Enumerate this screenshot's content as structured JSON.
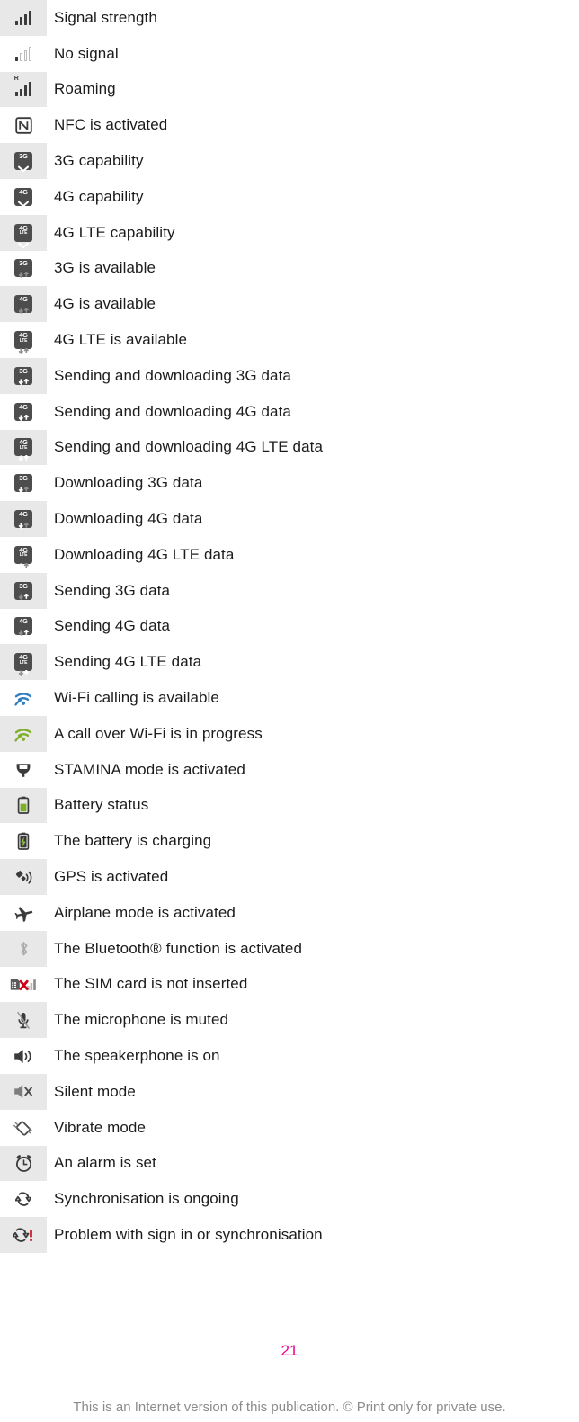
{
  "document": {
    "page_number": "21",
    "footer_note": "This is an Internet version of this publication. © Print only for private use.",
    "page_number_color": "#ec008c",
    "footer_note_color": "#8c8c8c",
    "row_shade_color": "#e8e8e8",
    "badge_color": "#4d4d4d"
  },
  "status_icons": {
    "rows": [
      {
        "icon": "signal-strength-icon",
        "label": "Signal strength",
        "shaded": true
      },
      {
        "icon": "no-signal-icon",
        "label": "No signal",
        "shaded": false
      },
      {
        "icon": "roaming-icon",
        "label": "Roaming",
        "shaded": true
      },
      {
        "icon": "nfc-icon",
        "label": "NFC is activated",
        "shaded": false
      },
      {
        "icon": "3g-capability-icon",
        "label": "3G capability",
        "shaded": true
      },
      {
        "icon": "4g-capability-icon",
        "label": "4G capability",
        "shaded": false
      },
      {
        "icon": "4g-lte-capability-icon",
        "label": "4G LTE capability",
        "shaded": true
      },
      {
        "icon": "3g-available-icon",
        "label": "3G is available",
        "shaded": false
      },
      {
        "icon": "4g-available-icon",
        "label": "4G is available",
        "shaded": true
      },
      {
        "icon": "4g-lte-available-icon",
        "label": "4G LTE is available",
        "shaded": false
      },
      {
        "icon": "3g-send-receive-icon",
        "label": "Sending and downloading 3G data",
        "shaded": true
      },
      {
        "icon": "4g-send-receive-icon",
        "label": "Sending and downloading 4G data",
        "shaded": false
      },
      {
        "icon": "4g-lte-send-receive-icon",
        "label": "Sending and downloading 4G LTE data",
        "shaded": true
      },
      {
        "icon": "3g-download-icon",
        "label": "Downloading 3G data",
        "shaded": false
      },
      {
        "icon": "4g-download-icon",
        "label": "Downloading 4G data",
        "shaded": true
      },
      {
        "icon": "4g-lte-download-icon",
        "label": "Downloading 4G LTE data",
        "shaded": false
      },
      {
        "icon": "3g-upload-icon",
        "label": "Sending 3G data",
        "shaded": true
      },
      {
        "icon": "4g-upload-icon",
        "label": "Sending 4G data",
        "shaded": false
      },
      {
        "icon": "4g-lte-upload-icon",
        "label": "Sending 4G LTE data",
        "shaded": true
      },
      {
        "icon": "wifi-calling-available-icon",
        "label": "Wi-Fi calling is available",
        "shaded": false
      },
      {
        "icon": "wifi-call-in-progress-icon",
        "label": "A call over Wi-Fi is in progress",
        "shaded": true
      },
      {
        "icon": "stamina-mode-icon",
        "label": "STAMINA mode is activated",
        "shaded": false
      },
      {
        "icon": "battery-status-icon",
        "label": "Battery status",
        "shaded": true
      },
      {
        "icon": "battery-charging-icon",
        "label": "The battery is charging",
        "shaded": false
      },
      {
        "icon": "gps-icon",
        "label": "GPS is activated",
        "shaded": true
      },
      {
        "icon": "airplane-mode-icon",
        "label": "Airplane mode is activated",
        "shaded": false
      },
      {
        "icon": "bluetooth-icon",
        "label": "The Bluetooth® function is activated",
        "shaded": true
      },
      {
        "icon": "no-sim-card-icon",
        "label": "The SIM card is not inserted",
        "shaded": false
      },
      {
        "icon": "microphone-muted-icon",
        "label": "The microphone is muted",
        "shaded": true
      },
      {
        "icon": "speakerphone-icon",
        "label": "The speakerphone is on",
        "shaded": false
      },
      {
        "icon": "silent-mode-icon",
        "label": "Silent mode",
        "shaded": true
      },
      {
        "icon": "vibrate-mode-icon",
        "label": "Vibrate mode",
        "shaded": false
      },
      {
        "icon": "alarm-icon",
        "label": "An alarm is set",
        "shaded": true
      },
      {
        "icon": "sync-ongoing-icon",
        "label": "Synchronisation is ongoing",
        "shaded": false
      },
      {
        "icon": "sync-problem-icon",
        "label": "Problem with sign in or synchronisation",
        "shaded": true
      }
    ]
  }
}
